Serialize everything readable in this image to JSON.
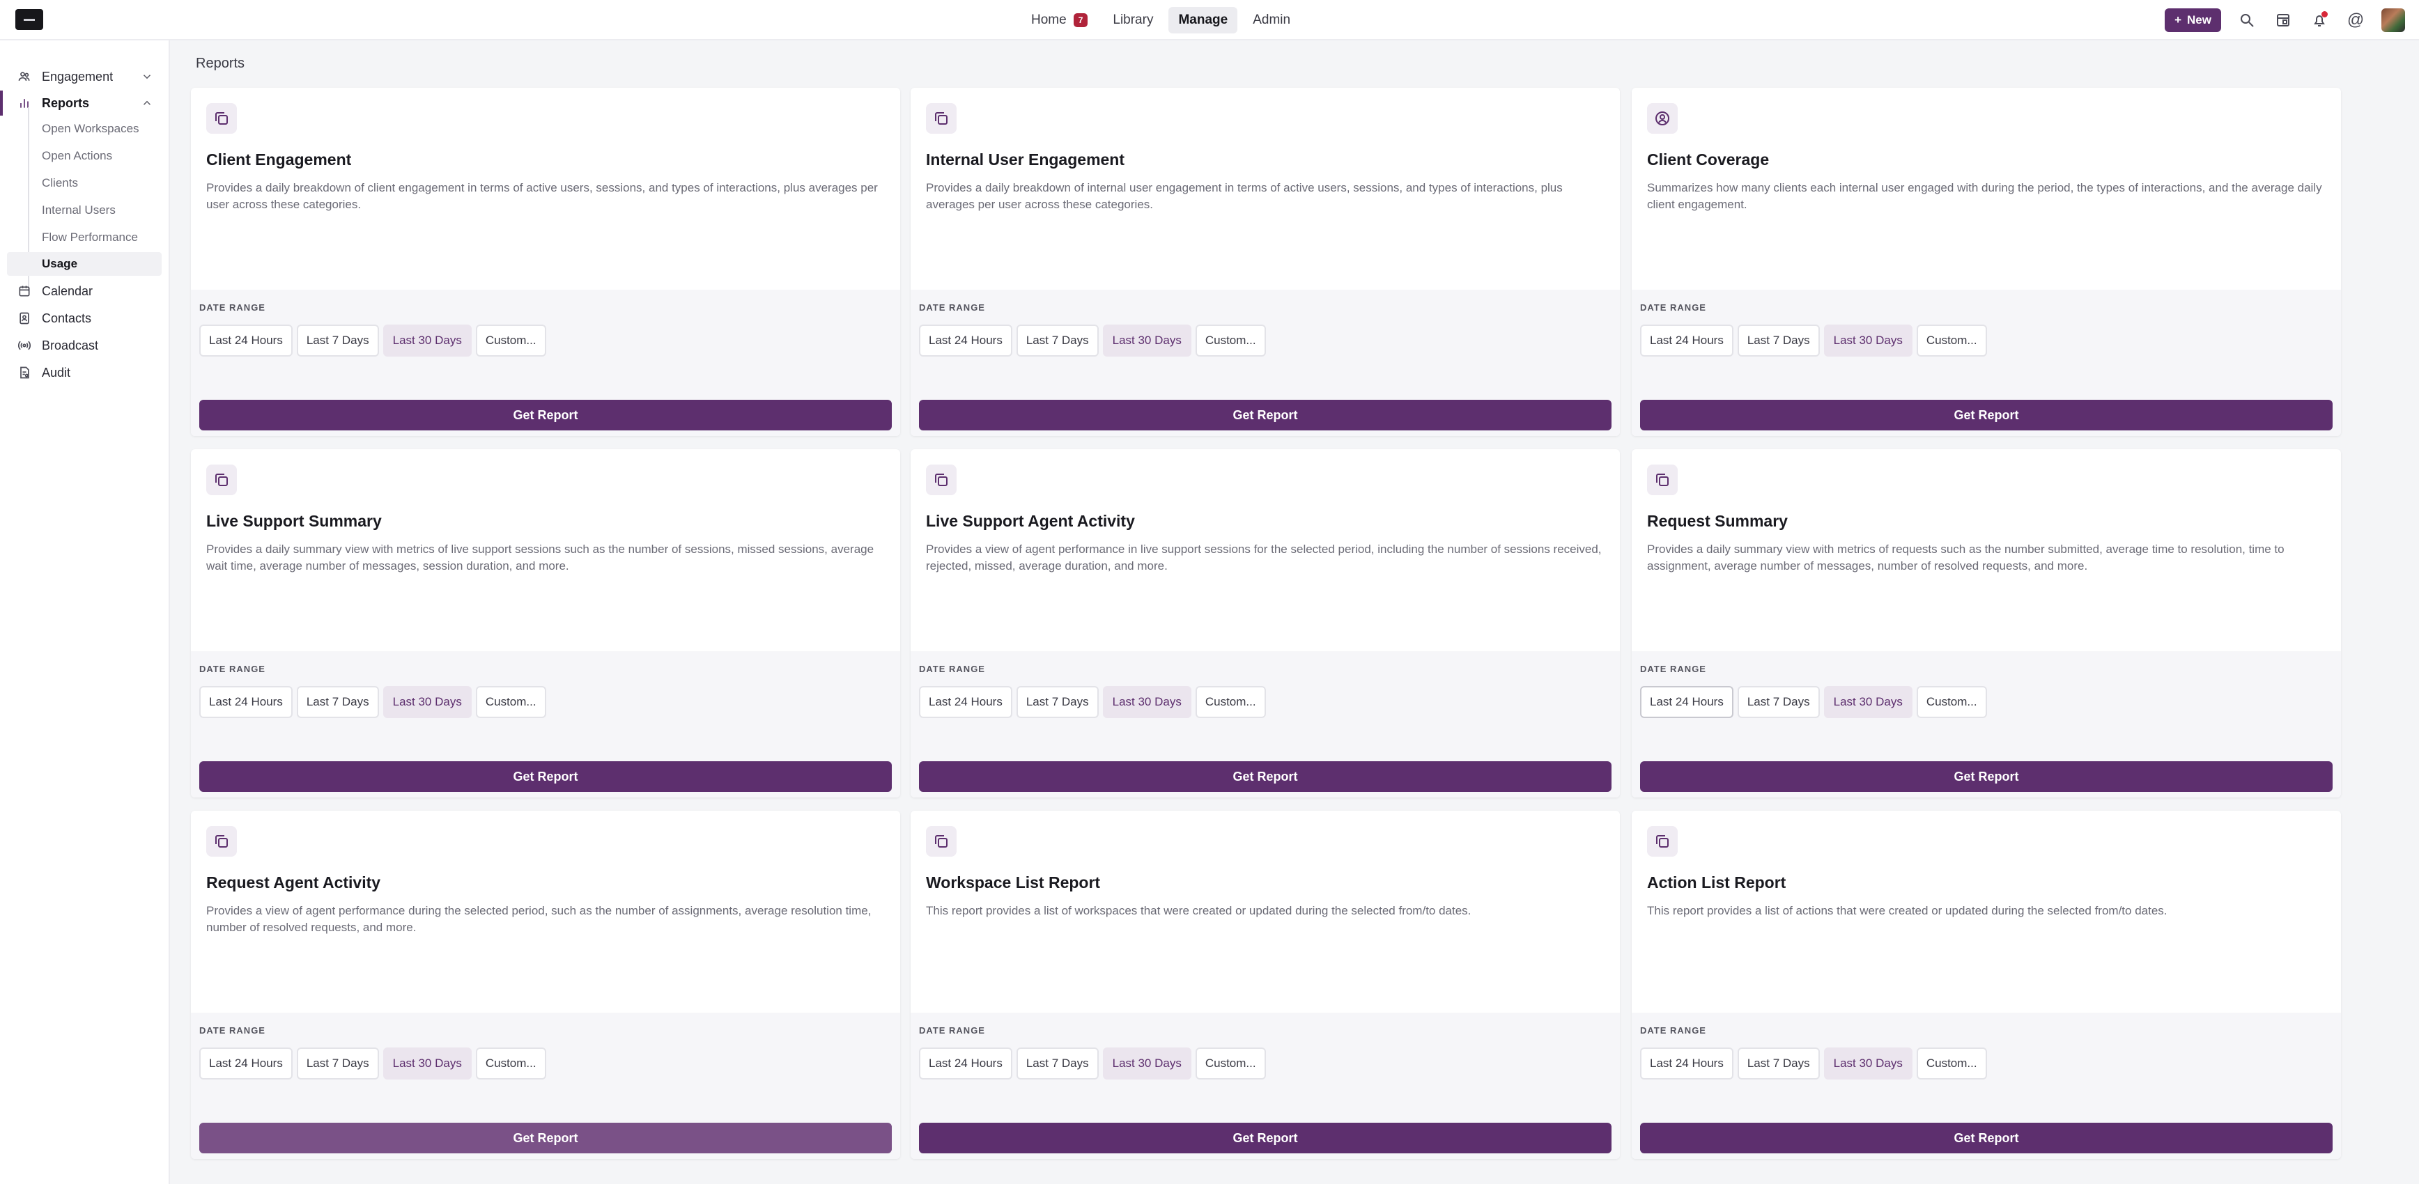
{
  "topnav": {
    "items": [
      {
        "label": "Home",
        "badge": "7"
      },
      {
        "label": "Library"
      },
      {
        "label": "Manage"
      },
      {
        "label": "Admin"
      }
    ],
    "new_label": "New"
  },
  "sidebar": {
    "items": [
      {
        "label": "Engagement",
        "icon": "people-icon"
      },
      {
        "label": "Reports",
        "icon": "bar-chart-icon"
      },
      {
        "label": "Calendar",
        "icon": "calendar-icon"
      },
      {
        "label": "Contacts",
        "icon": "contacts-icon"
      },
      {
        "label": "Broadcast",
        "icon": "broadcast-icon"
      },
      {
        "label": "Audit",
        "icon": "audit-icon"
      }
    ],
    "report_subitems": [
      "Open Workspaces",
      "Open Actions",
      "Clients",
      "Internal Users",
      "Flow Performance",
      "Usage"
    ]
  },
  "page": {
    "title": "Reports"
  },
  "common": {
    "date_range_label": "DATE RANGE",
    "ranges": [
      "Last 24 Hours",
      "Last 7 Days",
      "Last 30 Days",
      "Custom..."
    ],
    "selected_range": "Last 30 Days",
    "button_label": "Get Report"
  },
  "cards": [
    {
      "title": "Client Engagement",
      "description": "Provides a daily breakdown of client engagement in terms of active users, sessions, and types of interactions, plus averages per user across these categories.",
      "icon": "report-copy-icon"
    },
    {
      "title": "Internal User Engagement",
      "description": "Provides a daily breakdown of internal user engagement in terms of active users, sessions, and types of interactions, plus averages per user across these categories.",
      "icon": "report-copy-icon"
    },
    {
      "title": "Client Coverage",
      "description": "Summarizes how many clients each internal user engaged with during the period, the types of interactions, and the average daily client engagement.",
      "icon": "user-circle-icon"
    },
    {
      "title": "Live Support Summary",
      "description": "Provides a daily summary view with metrics of live support sessions such as the number of sessions, missed sessions, average wait time, average number of messages, session duration, and more.",
      "icon": "report-copy-icon"
    },
    {
      "title": "Live Support Agent Activity",
      "description": "Provides a view of agent performance in live support sessions for the selected period, including the number of sessions received, rejected, missed, average duration, and more.",
      "icon": "report-copy-icon"
    },
    {
      "title": "Request Summary",
      "description": "Provides a daily summary view with metrics of requests such as the number submitted, average time to resolution, time to assignment, average number of messages, number of resolved requests, and more.",
      "icon": "report-copy-icon"
    },
    {
      "title": "Request Agent Activity",
      "description": "Provides a view of agent performance during the selected period, such as the number of assignments, average resolution time, number of resolved requests, and more.",
      "icon": "report-copy-icon"
    },
    {
      "title": "Workspace List Report",
      "description": "This report provides a list of workspaces that were created or updated during the selected from/to dates.",
      "icon": "report-copy-icon"
    },
    {
      "title": "Action List Report",
      "description": "This report provides a list of actions that were created or updated during the selected from/to dates.",
      "icon": "report-copy-icon"
    }
  ]
}
